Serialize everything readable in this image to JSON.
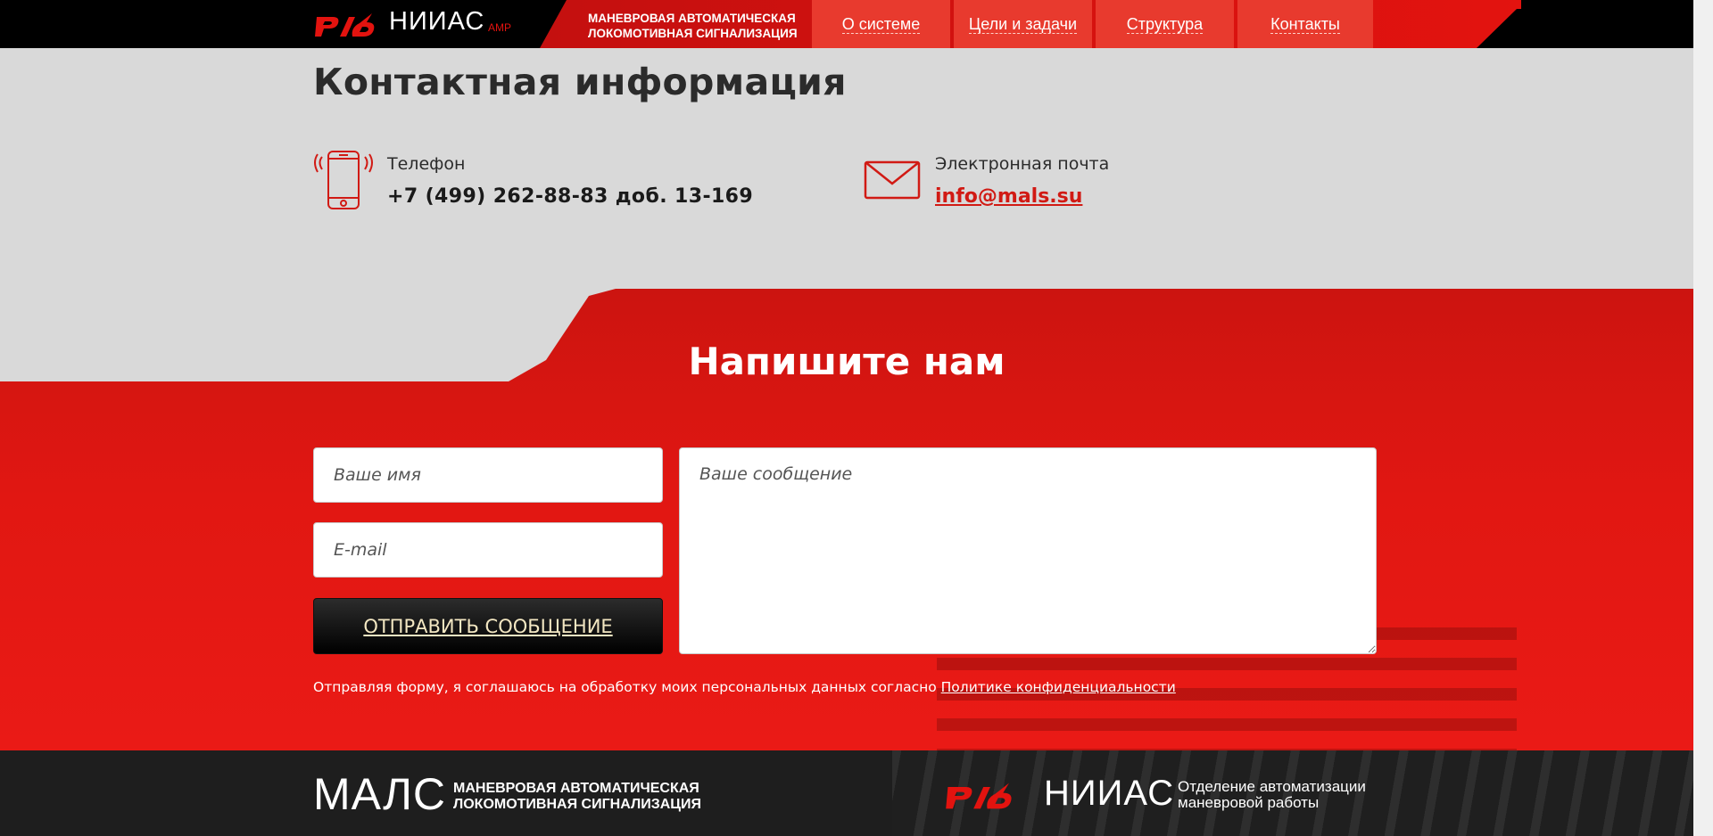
{
  "header": {
    "logo_rzd": "РЖД",
    "logo_niias": "НИИАС",
    "logo_badge": "АМР",
    "tagline_line1": "МАНЕВРОВАЯ АВТОМАТИЧЕСКАЯ",
    "tagline_line2": "ЛОКОМОТИВНАЯ СИГНАЛИЗАЦИЯ",
    "nav": [
      {
        "label": "О системе"
      },
      {
        "label": "Цели и задачи"
      },
      {
        "label": "Структура"
      },
      {
        "label": "Контакты"
      }
    ]
  },
  "contacts": {
    "title": "Контактная информация",
    "phone_label": "Телефон",
    "phone_value": "+7 (499) 262-88-83 доб. 13-169",
    "email_label": "Электронная почта",
    "email_value": "info@mals.su"
  },
  "form": {
    "title": "Напишите нам",
    "name_placeholder": "Ваше имя",
    "email_placeholder": "E-mail",
    "message_placeholder": "Ваше сообщение",
    "submit_label": "ОТПРАВИТЬ СООБЩЕНИЕ",
    "consent_text": "Отправляя форму, я соглашаюсь на обработку моих персональных данных согласно ",
    "consent_link": "Политике конфиденциальности"
  },
  "footer": {
    "mals": "МАЛС",
    "mals_desc_line1": "МАНЕВРОВАЯ АВТОМАТИЧЕСКАЯ",
    "mals_desc_line2": "ЛОКОМОТИВНАЯ СИГНАЛИЗАЦИЯ",
    "niias": "НИИАС",
    "niias_desc_line1": "Отделение автоматизации",
    "niias_desc_line2": "маневровой работы"
  },
  "colors": {
    "brand_red": "#e3130f",
    "dark": "#1e1e1e",
    "page_bg": "#d9d9d9"
  },
  "icons": [
    "phone-icon",
    "mail-icon",
    "rzd-logo"
  ]
}
